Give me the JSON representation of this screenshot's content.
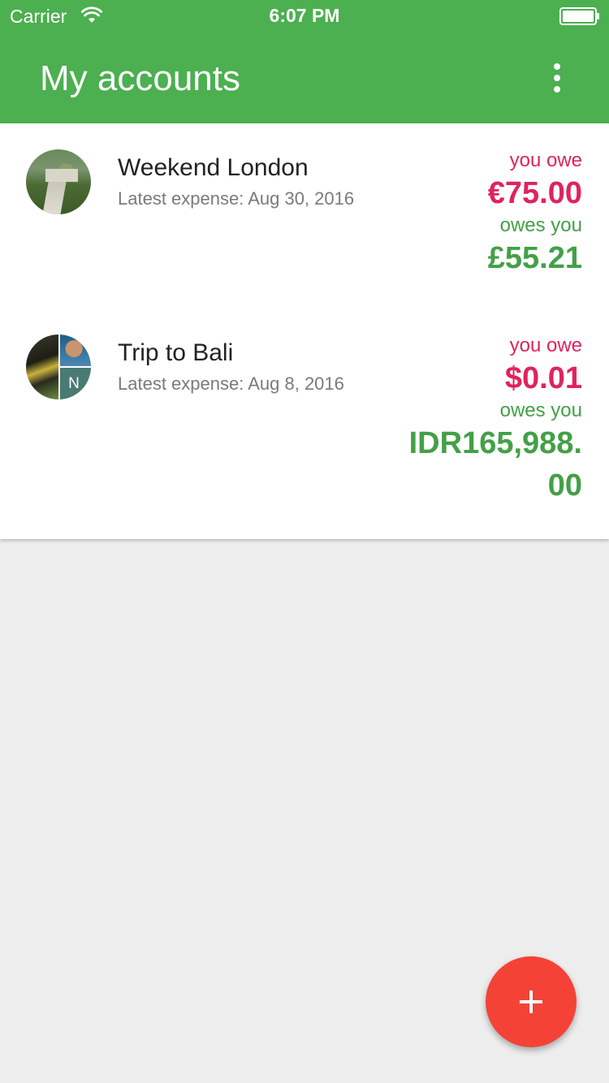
{
  "status_bar": {
    "carrier": "Carrier",
    "time": "6:07 PM"
  },
  "header": {
    "title": "My accounts",
    "menu_icon": "more-vert-icon"
  },
  "colors": {
    "header": "#4caf50",
    "owe": "#e0235d",
    "owed": "#43a047",
    "fab": "#f44336",
    "background": "#ededed"
  },
  "accounts": [
    {
      "name": "Weekend London",
      "latest_expense": "Latest expense: Aug 30, 2016",
      "you_owe_label": "you owe",
      "you_owe_amount": "€75.00",
      "owes_you_label": "owes you",
      "owes_you_amount": "£55.21"
    },
    {
      "name": "Trip to Bali",
      "latest_expense": "Latest expense: Aug 8, 2016",
      "avatar_initial": "N",
      "you_owe_label": "you owe",
      "you_owe_amount": "$0.01",
      "owes_you_label": "owes you",
      "owes_you_amount_line1": "IDR165,988.",
      "owes_you_amount_line2": "00"
    }
  ],
  "fab": {
    "icon": "plus-icon"
  }
}
